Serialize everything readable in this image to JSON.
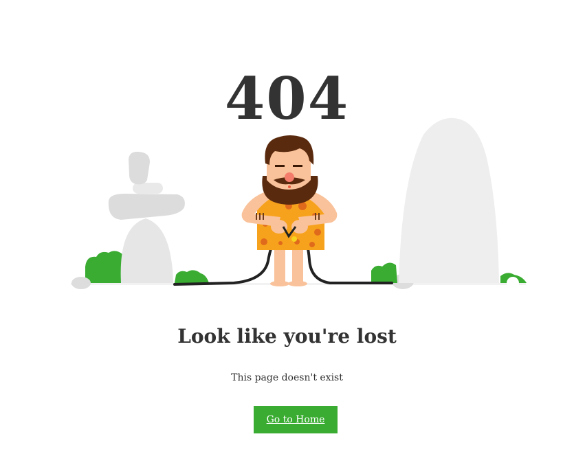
{
  "error": {
    "code": "404",
    "title": "Look like you're lost",
    "subtitle": "This page doesn't exist"
  },
  "actions": {
    "home_label": "Go to Home"
  },
  "colors": {
    "accent_green": "#39ac31",
    "text": "#333333",
    "rock": "#eeeeee",
    "skin": "#f9c29a",
    "hair": "#5a2a0e",
    "tunic": "#f7a21d"
  },
  "illustration": {
    "subject": "caveman-holding-unplugged-cable"
  }
}
